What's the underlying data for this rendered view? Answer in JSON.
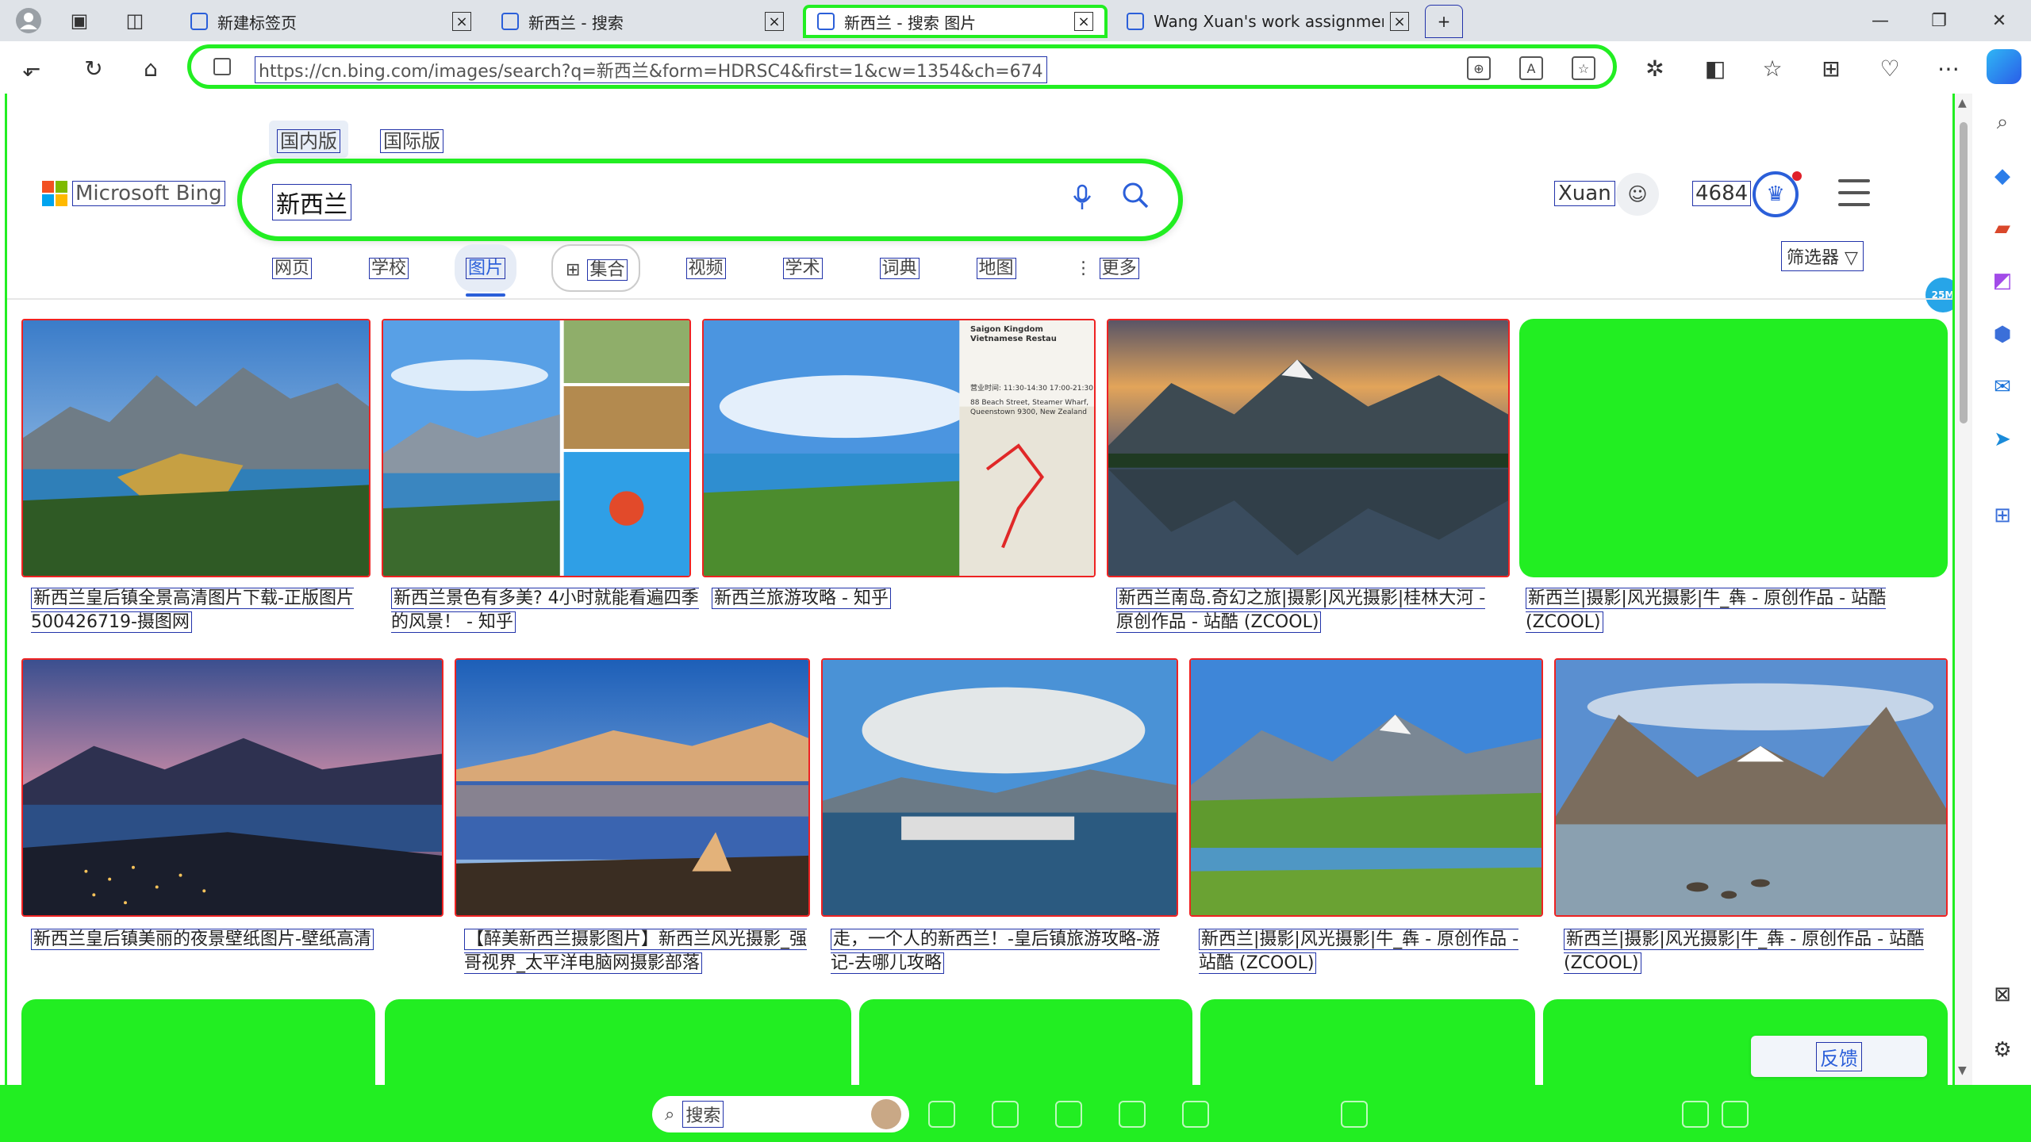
{
  "browser": {
    "tabs": [
      {
        "title": "新建标签页",
        "active": false
      },
      {
        "title": "新西兰 - 搜索",
        "active": false
      },
      {
        "title": "新西兰 - 搜索 图片",
        "active": true
      },
      {
        "title": "Wang Xuan's work assignment -",
        "active": false
      }
    ],
    "new_tab": "+",
    "url": "https://cn.bing.com/images/search?q=新西兰&form=HDRSC4&first=1&cw=1354&ch=674"
  },
  "bing": {
    "region_tabs": [
      "国内版",
      "国际版"
    ],
    "logo_text": "Microsoft Bing",
    "query": "新西兰",
    "user_name": "Xuan",
    "points": "4684",
    "nav": [
      "网页",
      "学校",
      "图片",
      "集合",
      "视频",
      "学术",
      "词典",
      "地图",
      "更多"
    ],
    "active_nav": "图片",
    "filter": "筛选器",
    "badge": "25M",
    "feedback": "反馈"
  },
  "results": {
    "row1": [
      {
        "caption": "新西兰皇后镇全景高清图片下载-正版图片500426719-摄图网"
      },
      {
        "caption": "新西兰景色有多美? 4小时就能看遍四季的风景！ - 知乎"
      },
      {
        "caption": "新西兰旅游攻略 - 知乎"
      },
      {
        "caption": "新西兰南岛.奇幻之旅|摄影|风光摄影|桂林大河 - 原创作品 - 站酷 (ZCOOL)"
      },
      {
        "caption": "新西兰|摄影|风光摄影|牛_犇 - 原创作品 - 站酷 (ZCOOL)"
      }
    ],
    "row2": [
      {
        "caption": "新西兰皇后镇美丽的夜景壁纸图片-壁纸高清"
      },
      {
        "caption": "【醉美新西兰摄影图片】新西兰风光摄影_强哥视界_太平洋电脑网摄影部落"
      },
      {
        "caption": "走，一个人的新西兰！-皇后镇旅游攻略-游记-去哪儿攻略"
      },
      {
        "caption": "新西兰|摄影|风光摄影|牛_犇 - 原创作品 - 站酷 (ZCOOL)"
      },
      {
        "caption": "新西兰|摄影|风光摄影|牛_犇 - 原创作品 - 站酷 (ZCOOL)"
      }
    ],
    "map_card": {
      "title": "Saigon Kingdom Vietnamese Restau",
      "address": "88 Beach Street, Steamer Wharf, Queenstown 9300, New Zealand",
      "hours": "营业时间: 11:30-14:30 17:00-21:30"
    }
  },
  "taskbar": {
    "search_label": "搜索"
  },
  "colors": {
    "accent": "#2b5fd9",
    "highlight": "#22ee22",
    "tile_border": "#ee2222"
  }
}
